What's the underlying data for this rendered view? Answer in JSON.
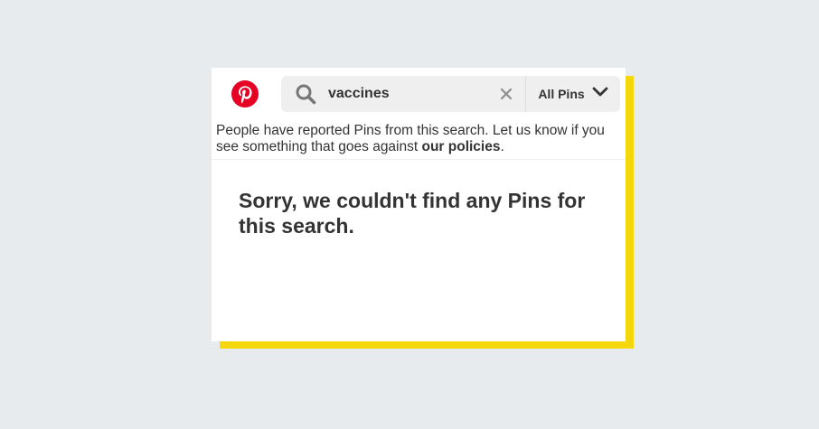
{
  "search": {
    "query": "vaccines",
    "filter_label": "All Pins"
  },
  "notice": {
    "text_before": "People have reported Pins from this search. Let us know if you see something that goes against ",
    "link_text": "our policies",
    "text_after": "."
  },
  "results": {
    "empty_message": "Sorry, we couldn't find any Pins for this search."
  },
  "icons": {
    "logo": "pinterest-logo-icon",
    "search": "search-icon",
    "clear": "close-icon",
    "filter": "chevron-down-icon"
  },
  "colors": {
    "brand_red": "#e60023",
    "accent_yellow": "#f5d80c",
    "background": "#e7ebee"
  }
}
